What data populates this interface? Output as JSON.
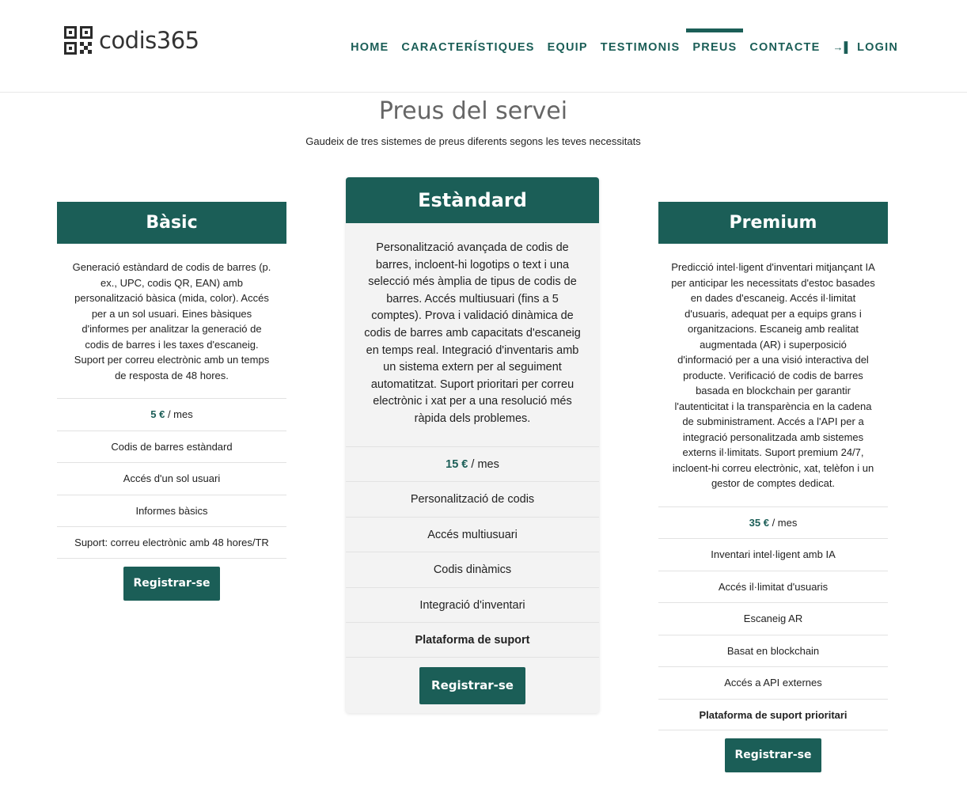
{
  "brand": {
    "name": "codis365",
    "icon": "qr-code-icon"
  },
  "nav": {
    "items": [
      {
        "label": "HOME"
      },
      {
        "label": "CARACTERÍSTIQUES"
      },
      {
        "label": "EQUIP"
      },
      {
        "label": "TESTIMONIS"
      },
      {
        "label": "PREUS",
        "active": true
      },
      {
        "label": "CONTACTE"
      },
      {
        "label": "LOGIN",
        "icon": "login-icon"
      }
    ]
  },
  "section": {
    "title": "Preus del servei",
    "subtitle": "Gaudeix de tres sistemes de preus diferents segons les teves necessitats"
  },
  "colors": {
    "accent": "#1b5e57",
    "standard_bg": "#f3f3f3"
  },
  "plans": [
    {
      "name": "Bàsic",
      "description": "Generació estàndard de codis de barres (p. ex., UPC, codis QR, EAN) amb personalització bàsica (mida, color). Accés per a un sol usuari. Eines bàsiques d'informes per analitzar la generació de codis de barres i les taxes d'escaneig. Suport per correu electrònic amb un temps de resposta de 48 hores.",
      "price": "5 €",
      "period": "/ mes",
      "features": [
        "Codis de barres estàndard",
        "Accés d'un sol usuari",
        "Informes bàsics",
        "Suport: correu electrònic amb 48 hores/TR"
      ],
      "button": "Registrar-se"
    },
    {
      "name": "Estàndard",
      "description": "Personalització avançada de codis de barres, incloent-hi logotips o text i una selecció més àmplia de tipus de codis de barres. Accés multiusuari (fins a 5 comptes). Prova i validació dinàmica de codis de barres amb capacitats d'escaneig en temps real. Integració d'inventaris amb un sistema extern per al seguiment automatitzat. Suport prioritari per correu electrònic i xat per a una resolució més ràpida dels problemes.",
      "price": "15 €",
      "period": "/ mes",
      "features": [
        "Personalització de codis",
        "Accés multiusuari",
        "Codis dinàmics",
        "Integració d'inventari",
        "Plataforma de suport"
      ],
      "button": "Registrar-se"
    },
    {
      "name": "Premium",
      "description": "Predicció intel·ligent d'inventari mitjançant IA per anticipar les necessitats d'estoc basades en dades d'escaneig. Accés il·limitat d'usuaris, adequat per a equips grans i organitzacions. Escaneig amb realitat augmentada (AR) i superposició d'informació per a una visió interactiva del producte. Verificació de codis de barres basada en blockchain per garantir l'autenticitat i la transparència en la cadena de subministrament. Accés a l'API per a integració personalitzada amb sistemes externs il·limitats. Suport premium 24/7, incloent-hi correu electrònic, xat, telèfon i un gestor de comptes dedicat.",
      "price": "35 €",
      "period": "/ mes",
      "features": [
        "Inventari intel·ligent amb IA",
        "Accés il·limitat d'usuaris",
        "Escaneig AR",
        "Basat en blockchain",
        "Accés a API externes",
        "Plataforma de suport prioritari"
      ],
      "button": "Registrar-se"
    }
  ]
}
